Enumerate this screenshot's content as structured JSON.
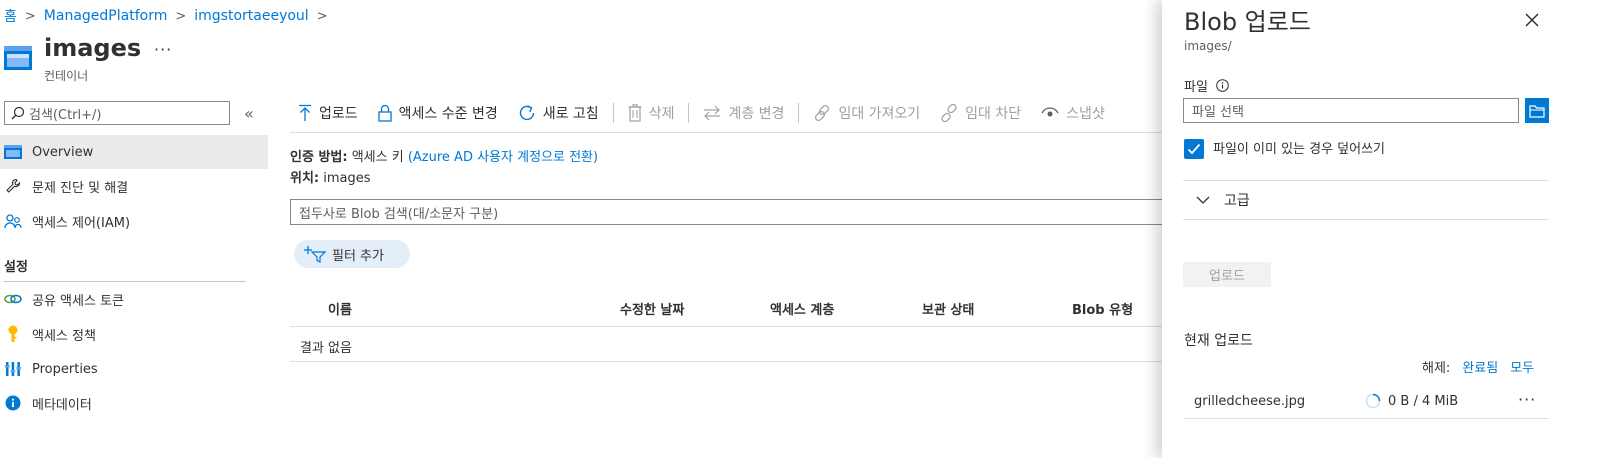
{
  "breadcrumb": [
    {
      "label": "홈"
    },
    {
      "label": "ManagedPlatform"
    },
    {
      "label": "imgstortaeeyoul"
    }
  ],
  "header": {
    "title": "images",
    "subtitle": "컨테이너",
    "more": "···"
  },
  "sidebar": {
    "search_placeholder": "검색(Ctrl+/)",
    "collapse": "«",
    "items": [
      {
        "label": "Overview",
        "icon": "container-icon",
        "active": true
      },
      {
        "label": "문제 진단 및 해결",
        "icon": "wrench-icon"
      },
      {
        "label": "액세스 제어(IAM)",
        "icon": "people-icon"
      }
    ],
    "settings_header": "설정",
    "settings_items": [
      {
        "label": "공유 액세스 토큰",
        "icon": "link-icon"
      },
      {
        "label": "액세스 정책",
        "icon": "key-icon"
      },
      {
        "label": "Properties",
        "icon": "properties-icon"
      },
      {
        "label": "메타데이터",
        "icon": "info-icon"
      }
    ]
  },
  "toolbar": {
    "upload": "업로드",
    "access_level": "액세스 수준 변경",
    "refresh": "새로 고침",
    "delete": "삭제",
    "change_tier": "계층 변경",
    "acquire_lease": "임대 가져오기",
    "break_lease": "임대 차단",
    "snapshot": "스냅샷"
  },
  "main": {
    "auth_label": "인증 방법:",
    "auth_value": "액세스 키",
    "auth_link": "(Azure AD 사용자 계정으로 전환)",
    "location_label": "위치:",
    "location_value": "images",
    "blob_search_placeholder": "접두사로 Blob 검색(대/소문자 구분)",
    "add_filter": "필터 추가",
    "columns": [
      "이름",
      "수정한 날짜",
      "액세스 계층",
      "보관 상태",
      "Blob 유형"
    ],
    "no_results": "결과 없음"
  },
  "panel": {
    "title": "Blob 업로드",
    "subtitle": "images/",
    "file_label": "파일",
    "file_placeholder": "파일 선택",
    "overwrite_label": "파일이 이미 있는 경우 덮어쓰기",
    "overwrite_checked": true,
    "advanced": "고급",
    "upload_button": "업로드",
    "current_uploads": "현재 업로드",
    "clear_label": "해제:",
    "clear_completed": "완료됨",
    "clear_all": "모두",
    "uploads": [
      {
        "file": "grilledcheese.jpg",
        "progress": "0 B / 4 MiB",
        "more": "···"
      }
    ]
  },
  "colors": {
    "accent": "#0078d4",
    "active_bg": "#edebe9",
    "filter_bg": "#e3eef9"
  }
}
